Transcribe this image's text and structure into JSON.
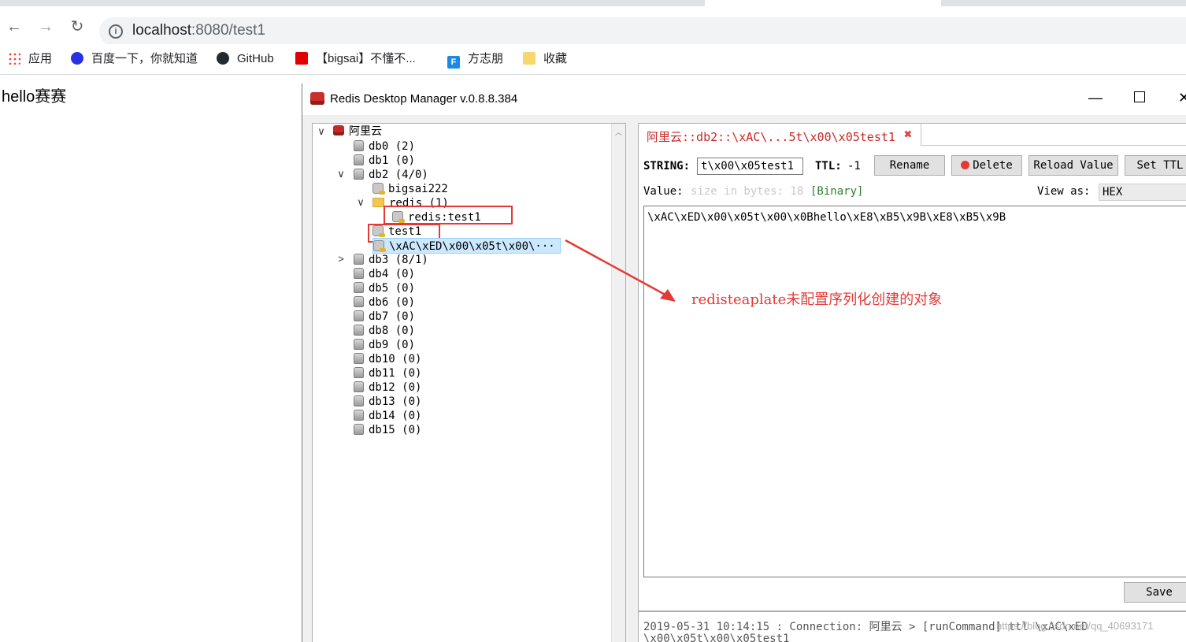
{
  "browser": {
    "url_host": "localhost",
    "url_path": ":8080/test1",
    "bookmarks": [
      {
        "label": "应用",
        "icon": "apps-grid-icon",
        "color": "#ea4335"
      },
      {
        "label": "百度一下，你就知道",
        "icon": "baidu-paw-icon",
        "color": "#2932e1"
      },
      {
        "label": "GitHub",
        "icon": "github-icon",
        "color": "#24292e"
      },
      {
        "label": "【bigsai】不懂不...",
        "icon": "csdn-icon",
        "color": "#e00000"
      },
      {
        "label": "方志朋",
        "icon": "blog-f-icon",
        "color": "#1e88e5"
      },
      {
        "label": "收藏",
        "icon": "folder-icon",
        "color": "#f5c542"
      }
    ]
  },
  "page": {
    "text": "hello赛赛"
  },
  "rdm": {
    "window_title": "Redis Desktop Manager v.0.8.8.384",
    "tree": {
      "server": "阿里云",
      "db0": "db0  (2)",
      "db1": "db1  (0)",
      "db2": "db2  (4/0)",
      "key_bigsai": "bigsai222",
      "folder_redis": "redis  (1)",
      "key_redis_test1": "redis:test1",
      "key_test1": "test1",
      "key_serialized": "\\xAC\\xED\\x00\\x05t\\x00\\···",
      "db3": "db3  (8/1)",
      "db4": "db4  (0)",
      "db5": "db5  (0)",
      "db6": "db6  (0)",
      "db7": "db7  (0)",
      "db8": "db8  (0)",
      "db9": "db9  (0)",
      "db10": "db10  (0)",
      "db11": "db11  (0)",
      "db12": "db12  (0)",
      "db13": "db13  (0)",
      "db14": "db14  (0)",
      "db15": "db15  (0)"
    },
    "key_tab": {
      "title": "阿里云::db2::\\xAC\\...5t\\x00\\x05test1",
      "close": "✖"
    },
    "key_view": {
      "type_label": "STRING:",
      "key_name": "t\\x00\\x05test1",
      "ttl_label": "TTL:",
      "ttl_value": "-1",
      "rename": "Rename",
      "delete": "Delete",
      "reload": "Reload Value",
      "set_ttl": "Set TTL",
      "value_label": "Value:",
      "size_hint": "size in bytes: 18",
      "binary_tag": "[Binary]",
      "view_as_label": "View as:",
      "view_as_value": "HEX",
      "value": "\\xAC\\xED\\x00\\x05t\\x00\\x0Bhello\\xE8\\xB5\\x9B\\xE8\\xB5\\x9B",
      "save": "Save"
    },
    "log": {
      "line1": "2019-05-31 10:14:15 : Connection: 阿里云 > [runCommand] ttl \\xAC\\xED",
      "line2": "\\x00\\x05t\\x00\\x05test1"
    }
  },
  "annotation": "redisteaplate未配置序列化创建的对象",
  "watermark": "https://blog.csdn.net/qq_40693171"
}
